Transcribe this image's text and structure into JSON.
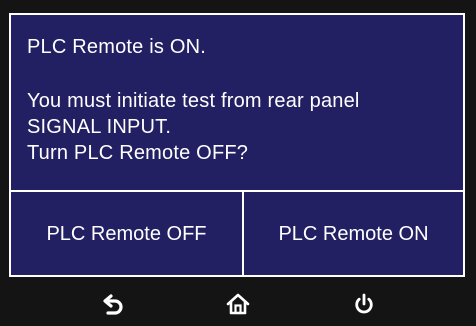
{
  "dialog": {
    "message_lines": [
      "PLC Remote is ON.",
      "You must initiate test from rear panel",
      "SIGNAL INPUT.",
      "Turn PLC Remote OFF?"
    ],
    "buttons": {
      "off_label": "PLC Remote OFF",
      "on_label": "PLC Remote ON"
    }
  },
  "nav": {
    "items": [
      {
        "icon": "back-arrow-icon"
      },
      {
        "icon": "home-icon"
      },
      {
        "icon": "power-icon"
      }
    ]
  },
  "colors": {
    "dialog_background": "#222062",
    "screen_background": "#141414",
    "text": "#ffffff",
    "border": "#ffffff"
  }
}
